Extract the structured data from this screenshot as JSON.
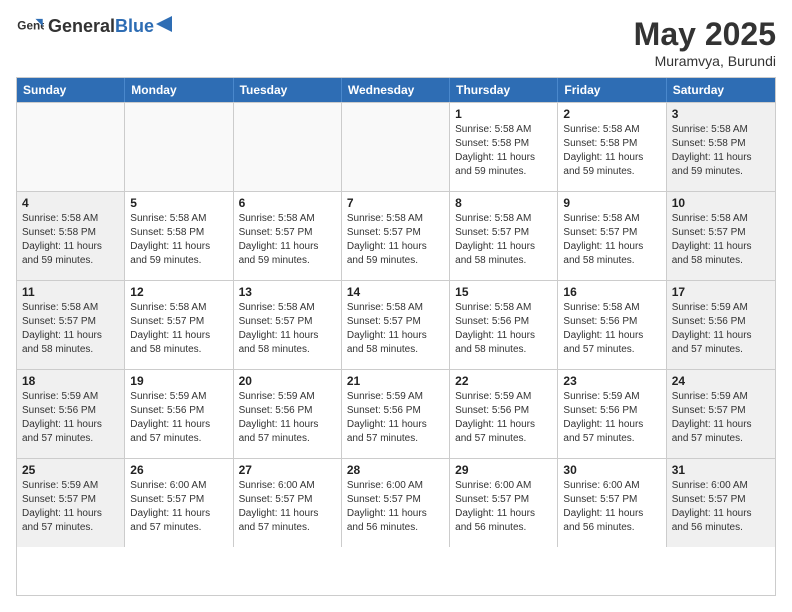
{
  "header": {
    "logo_general": "General",
    "logo_blue": "Blue",
    "title": "May 2025",
    "location": "Muramvya, Burundi"
  },
  "weekdays": [
    "Sunday",
    "Monday",
    "Tuesday",
    "Wednesday",
    "Thursday",
    "Friday",
    "Saturday"
  ],
  "weeks": [
    [
      {
        "day": "",
        "info": "",
        "empty": true
      },
      {
        "day": "",
        "info": "",
        "empty": true
      },
      {
        "day": "",
        "info": "",
        "empty": true
      },
      {
        "day": "",
        "info": "",
        "empty": true
      },
      {
        "day": "1",
        "info": "Sunrise: 5:58 AM\nSunset: 5:58 PM\nDaylight: 11 hours\nand 59 minutes."
      },
      {
        "day": "2",
        "info": "Sunrise: 5:58 AM\nSunset: 5:58 PM\nDaylight: 11 hours\nand 59 minutes."
      },
      {
        "day": "3",
        "info": "Sunrise: 5:58 AM\nSunset: 5:58 PM\nDaylight: 11 hours\nand 59 minutes."
      }
    ],
    [
      {
        "day": "4",
        "info": "Sunrise: 5:58 AM\nSunset: 5:58 PM\nDaylight: 11 hours\nand 59 minutes."
      },
      {
        "day": "5",
        "info": "Sunrise: 5:58 AM\nSunset: 5:58 PM\nDaylight: 11 hours\nand 59 minutes."
      },
      {
        "day": "6",
        "info": "Sunrise: 5:58 AM\nSunset: 5:57 PM\nDaylight: 11 hours\nand 59 minutes."
      },
      {
        "day": "7",
        "info": "Sunrise: 5:58 AM\nSunset: 5:57 PM\nDaylight: 11 hours\nand 59 minutes."
      },
      {
        "day": "8",
        "info": "Sunrise: 5:58 AM\nSunset: 5:57 PM\nDaylight: 11 hours\nand 58 minutes."
      },
      {
        "day": "9",
        "info": "Sunrise: 5:58 AM\nSunset: 5:57 PM\nDaylight: 11 hours\nand 58 minutes."
      },
      {
        "day": "10",
        "info": "Sunrise: 5:58 AM\nSunset: 5:57 PM\nDaylight: 11 hours\nand 58 minutes."
      }
    ],
    [
      {
        "day": "11",
        "info": "Sunrise: 5:58 AM\nSunset: 5:57 PM\nDaylight: 11 hours\nand 58 minutes."
      },
      {
        "day": "12",
        "info": "Sunrise: 5:58 AM\nSunset: 5:57 PM\nDaylight: 11 hours\nand 58 minutes."
      },
      {
        "day": "13",
        "info": "Sunrise: 5:58 AM\nSunset: 5:57 PM\nDaylight: 11 hours\nand 58 minutes."
      },
      {
        "day": "14",
        "info": "Sunrise: 5:58 AM\nSunset: 5:57 PM\nDaylight: 11 hours\nand 58 minutes."
      },
      {
        "day": "15",
        "info": "Sunrise: 5:58 AM\nSunset: 5:56 PM\nDaylight: 11 hours\nand 58 minutes."
      },
      {
        "day": "16",
        "info": "Sunrise: 5:58 AM\nSunset: 5:56 PM\nDaylight: 11 hours\nand 57 minutes."
      },
      {
        "day": "17",
        "info": "Sunrise: 5:59 AM\nSunset: 5:56 PM\nDaylight: 11 hours\nand 57 minutes."
      }
    ],
    [
      {
        "day": "18",
        "info": "Sunrise: 5:59 AM\nSunset: 5:56 PM\nDaylight: 11 hours\nand 57 minutes."
      },
      {
        "day": "19",
        "info": "Sunrise: 5:59 AM\nSunset: 5:56 PM\nDaylight: 11 hours\nand 57 minutes."
      },
      {
        "day": "20",
        "info": "Sunrise: 5:59 AM\nSunset: 5:56 PM\nDaylight: 11 hours\nand 57 minutes."
      },
      {
        "day": "21",
        "info": "Sunrise: 5:59 AM\nSunset: 5:56 PM\nDaylight: 11 hours\nand 57 minutes."
      },
      {
        "day": "22",
        "info": "Sunrise: 5:59 AM\nSunset: 5:56 PM\nDaylight: 11 hours\nand 57 minutes."
      },
      {
        "day": "23",
        "info": "Sunrise: 5:59 AM\nSunset: 5:56 PM\nDaylight: 11 hours\nand 57 minutes."
      },
      {
        "day": "24",
        "info": "Sunrise: 5:59 AM\nSunset: 5:57 PM\nDaylight: 11 hours\nand 57 minutes."
      }
    ],
    [
      {
        "day": "25",
        "info": "Sunrise: 5:59 AM\nSunset: 5:57 PM\nDaylight: 11 hours\nand 57 minutes."
      },
      {
        "day": "26",
        "info": "Sunrise: 6:00 AM\nSunset: 5:57 PM\nDaylight: 11 hours\nand 57 minutes."
      },
      {
        "day": "27",
        "info": "Sunrise: 6:00 AM\nSunset: 5:57 PM\nDaylight: 11 hours\nand 57 minutes."
      },
      {
        "day": "28",
        "info": "Sunrise: 6:00 AM\nSunset: 5:57 PM\nDaylight: 11 hours\nand 56 minutes."
      },
      {
        "day": "29",
        "info": "Sunrise: 6:00 AM\nSunset: 5:57 PM\nDaylight: 11 hours\nand 56 minutes."
      },
      {
        "day": "30",
        "info": "Sunrise: 6:00 AM\nSunset: 5:57 PM\nDaylight: 11 hours\nand 56 minutes."
      },
      {
        "day": "31",
        "info": "Sunrise: 6:00 AM\nSunset: 5:57 PM\nDaylight: 11 hours\nand 56 minutes."
      }
    ]
  ]
}
